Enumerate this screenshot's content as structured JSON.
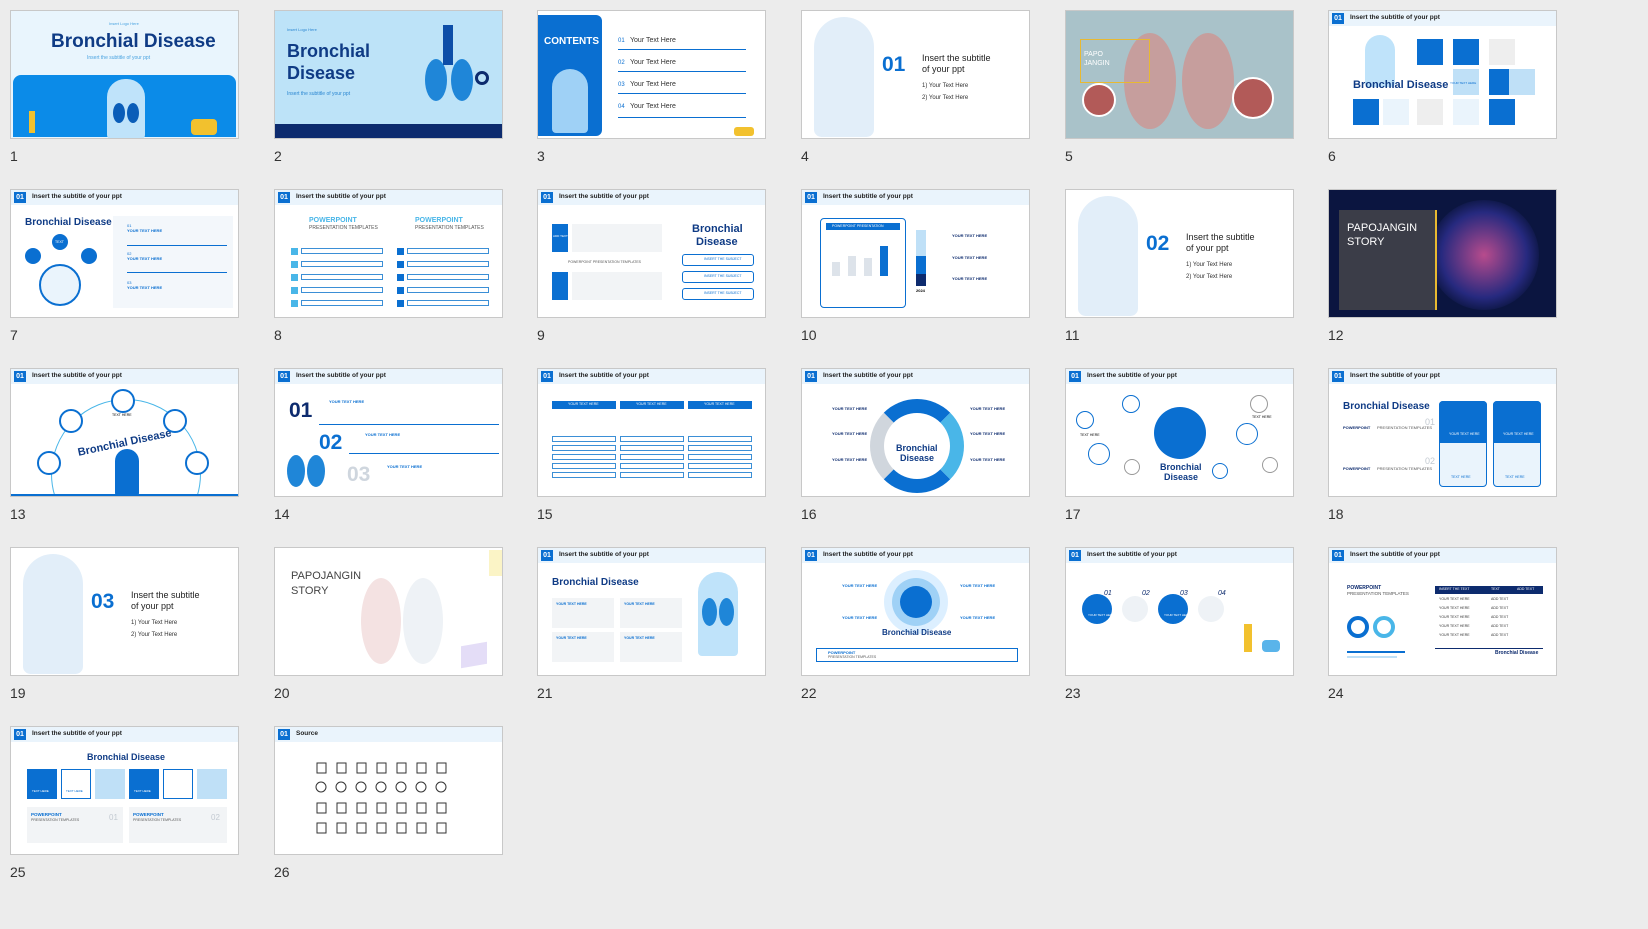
{
  "slides": [
    {
      "num": "1",
      "small": "Insert Logo Here",
      "title": "Bronchial Disease",
      "subtitle": "Insert the subtitle of your ppt"
    },
    {
      "num": "2",
      "small": "Insert Logo Here",
      "title_l1": "Bronchial",
      "title_l2": "Disease",
      "subtitle": "Insert the subtitle of your ppt"
    },
    {
      "num": "3",
      "contents": "CONTENTS",
      "items": [
        {
          "n": "01",
          "t": "Your Text Here"
        },
        {
          "n": "02",
          "t": "Your Text Here"
        },
        {
          "n": "03",
          "t": "Your Text Here"
        },
        {
          "n": "04",
          "t": "Your Text Here"
        }
      ]
    },
    {
      "num": "4",
      "section": "01",
      "sub_l1": "Insert the subtitle",
      "sub_l2": "of your ppt",
      "p1": "1) Your Text Here",
      "p2": "2) Your Text Here"
    },
    {
      "num": "5",
      "label_l1": "PAPO",
      "label_l2": "JANGIN"
    },
    {
      "num": "6",
      "hdr_num": "01",
      "hdr": "Insert the subtitle of your ppt",
      "title": "Bronchial Disease",
      "cell": "YOUR TEXT HERE"
    },
    {
      "num": "7",
      "hdr_num": "01",
      "hdr": "Insert the subtitle of your ppt",
      "title": "Bronchial Disease",
      "node": "TEXT",
      "rows": [
        {
          "n": "01",
          "t": "YOUR TEXT HERE"
        },
        {
          "n": "02",
          "t": "YOUR TEXT HERE"
        },
        {
          "n": "03",
          "t": "YOUR TEXT HERE"
        }
      ]
    },
    {
      "num": "8",
      "hdr_num": "01",
      "hdr": "Insert the subtitle of your ppt",
      "pp": "POWERPOINT",
      "pt": "PRESENTATION TEMPLATES"
    },
    {
      "num": "9",
      "hdr_num": "01",
      "hdr": "Insert the subtitle of your ppt",
      "add": "ADD TEXT",
      "title_l1": "Bronchial",
      "title_l2": "Disease",
      "ppt": "POWERPOINT PRESENTATION TEMPLATES",
      "btn": "INSERT THE SUBJECT"
    },
    {
      "num": "10",
      "hdr_num": "01",
      "hdr": "Insert the subtitle of your ppt",
      "chart": "POWERPOINT PRESENTATION",
      "year": "2024",
      "label": "YOUR TEXT HERE"
    },
    {
      "num": "11",
      "section": "02",
      "sub_l1": "Insert the subtitle",
      "sub_l2": "of your ppt",
      "p1": "1) Your Text Here",
      "p2": "2) Your Text Here"
    },
    {
      "num": "12",
      "title_l1": "PAPOJANGIN",
      "title_l2": "STORY"
    },
    {
      "num": "13",
      "hdr_num": "01",
      "hdr": "Insert the subtitle of your ppt",
      "title": "Bronchial Disease",
      "node": "TEXT HERE"
    },
    {
      "num": "14",
      "hdr_num": "01",
      "hdr": "Insert the subtitle of your ppt",
      "n1": "01",
      "n2": "02",
      "n3": "03",
      "label": "YOUR TEXT HERE"
    },
    {
      "num": "15",
      "hdr_num": "01",
      "hdr": "Insert the subtitle of your ppt",
      "col": "YOUR TEXT HERE"
    },
    {
      "num": "16",
      "hdr_num": "01",
      "hdr": "Insert the subtitle of your ppt",
      "title_l1": "Bronchial",
      "title_l2": "Disease",
      "label": "YOUR TEXT HERE"
    },
    {
      "num": "17",
      "hdr_num": "01",
      "hdr": "Insert the subtitle of your ppt",
      "title_l1": "Bronchial",
      "title_l2": "Disease",
      "node": "TEXT HERE"
    },
    {
      "num": "18",
      "hdr_num": "01",
      "hdr": "Insert the subtitle of your ppt",
      "title": "Bronchial Disease",
      "pp": "POWERPOINT",
      "pt": "PRESENTATION TEMPLATES",
      "n1": "01",
      "n2": "02",
      "card": "YOUR TEXT HERE",
      "link": "TEXT HERE"
    },
    {
      "num": "19",
      "section": "03",
      "sub_l1": "Insert the subtitle",
      "sub_l2": "of your ppt",
      "p1": "1) Your Text Here",
      "p2": "2) Your Text Here"
    },
    {
      "num": "20",
      "title_l1": "PAPOJANGIN",
      "title_l2": "STORY"
    },
    {
      "num": "21",
      "hdr_num": "01",
      "hdr": "Insert the subtitle of your ppt",
      "title": "Bronchial Disease",
      "label": "YOUR TEXT HERE"
    },
    {
      "num": "22",
      "hdr_num": "01",
      "hdr": "Insert the subtitle of your ppt",
      "center": "Bronchial Disease",
      "label": "YOUR TEXT HERE",
      "pp": "POWERPOINT",
      "pt": "PRESENTATION TEMPLATES"
    },
    {
      "num": "23",
      "hdr_num": "01",
      "hdr": "Insert the subtitle of your ppt",
      "steps": [
        "01",
        "02",
        "03",
        "04"
      ],
      "label": "YOUR TEXT HERE"
    },
    {
      "num": "24",
      "hdr_num": "01",
      "hdr": "Insert the subtitle of your ppt",
      "pp": "POWERPOINT",
      "pt": "PRESENTATION TEMPLATES",
      "th1": "INSERT THE TEXT",
      "th2": "TEXT",
      "th3": "ADD TEXT",
      "cell1": "YOUR TEXT HERE",
      "cell2": "ADD TEXT",
      "footer": "Bronchial Disease"
    },
    {
      "num": "25",
      "hdr_num": "01",
      "hdr": "Insert the subtitle of your ppt",
      "title": "Bronchial Disease",
      "box": "TEXT HERE",
      "pp": "POWERPOINT",
      "pt": "PRESENTATION TEMPLATES",
      "n1": "01",
      "n2": "02"
    },
    {
      "num": "26",
      "hdr_num": "01",
      "hdr": "Source"
    }
  ]
}
